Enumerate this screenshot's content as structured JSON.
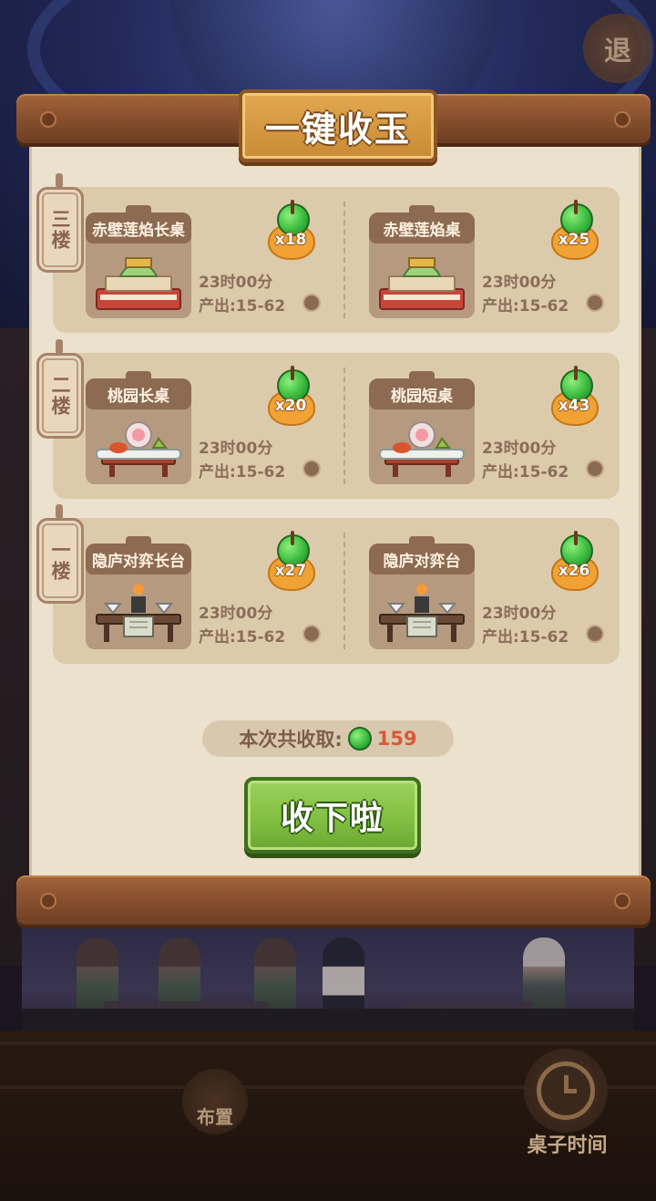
{
  "dialog": {
    "title": "一键收玉",
    "floors": [
      {
        "label": "三楼",
        "tables": [
          {
            "name": "赤壁莲焰长桌",
            "jade_count": "x18",
            "time": "23时00分",
            "output": "产出:15-62",
            "style": "lotus"
          },
          {
            "name": "赤壁莲焰桌",
            "jade_count": "x25",
            "time": "23时00分",
            "output": "产出:15-62",
            "style": "lotus"
          }
        ]
      },
      {
        "label": "二楼",
        "tables": [
          {
            "name": "桃园长桌",
            "jade_count": "x20",
            "time": "23时00分",
            "output": "产出:15-62",
            "style": "peach"
          },
          {
            "name": "桃园短桌",
            "jade_count": "x43",
            "time": "23时00分",
            "output": "产出:15-62",
            "style": "peach"
          }
        ]
      },
      {
        "label": "一楼",
        "tables": [
          {
            "name": "隐庐对弈长台",
            "jade_count": "x27",
            "time": "23时00分",
            "output": "产出:15-62",
            "style": "chess"
          },
          {
            "name": "隐庐对弈台",
            "jade_count": "x26",
            "time": "23时00分",
            "output": "产出:15-62",
            "style": "chess"
          }
        ]
      }
    ],
    "total_label": "本次共收取:",
    "total_value": "159",
    "collect_button": "收下啦"
  },
  "background": {
    "exit_button": "退",
    "layout_button": "布置",
    "table_time_button": "桌子时间"
  },
  "colors": {
    "paper": "#ece1cc",
    "row": "#dccbaa",
    "accent_green": "#7fbd40",
    "total_value": "#d65a3a",
    "title_gold": "#d69a42"
  }
}
